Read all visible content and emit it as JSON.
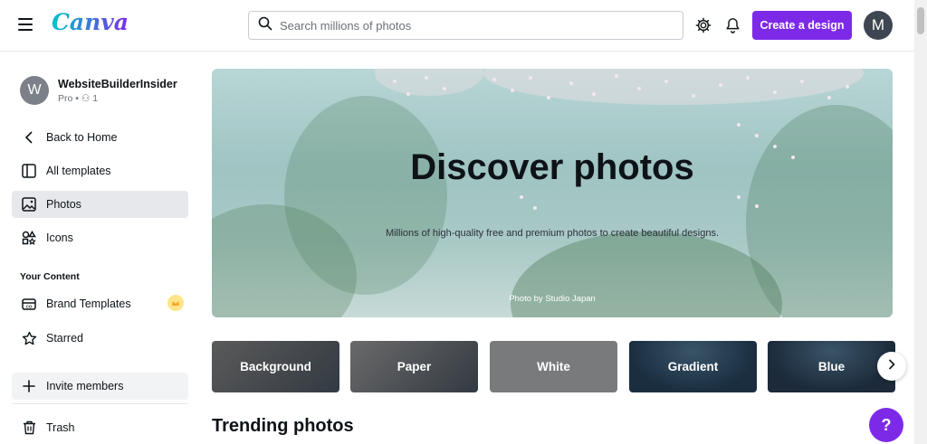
{
  "app": {
    "logo": "Canva"
  },
  "header": {
    "search_placeholder": "Search millions of photos",
    "create_label": "Create a design",
    "avatar_initial": "M"
  },
  "account": {
    "initial": "W",
    "name": "WebsiteBuilderInsider",
    "plan": "Pro",
    "members": "1"
  },
  "sidebar": {
    "back": "Back to Home",
    "all_templates": "All templates",
    "photos": "Photos",
    "icons": "Icons",
    "section": "Your Content",
    "brand_templates": "Brand Templates",
    "starred": "Starred",
    "invite": "Invite members",
    "trash": "Trash"
  },
  "hero": {
    "title": "Discover photos",
    "subtitle": "Millions of high-quality free and premium photos to create beautiful designs.",
    "credit_prefix": "Photo by",
    "credit_author": "Studio Japan"
  },
  "categories": [
    {
      "label": "Background",
      "color": "#5a5a5a"
    },
    {
      "label": "Paper",
      "color": "#6a6a6a"
    },
    {
      "label": "White",
      "color": "#787a7c"
    },
    {
      "label": "Gradient",
      "color": "#1a2e40"
    },
    {
      "label": "Blue",
      "color": "#1c2a3a"
    }
  ],
  "section_title": "Trending photos",
  "help_label": "?",
  "colors": {
    "accent": "#7d2ae8",
    "active_bg": "#e6e8eb"
  }
}
